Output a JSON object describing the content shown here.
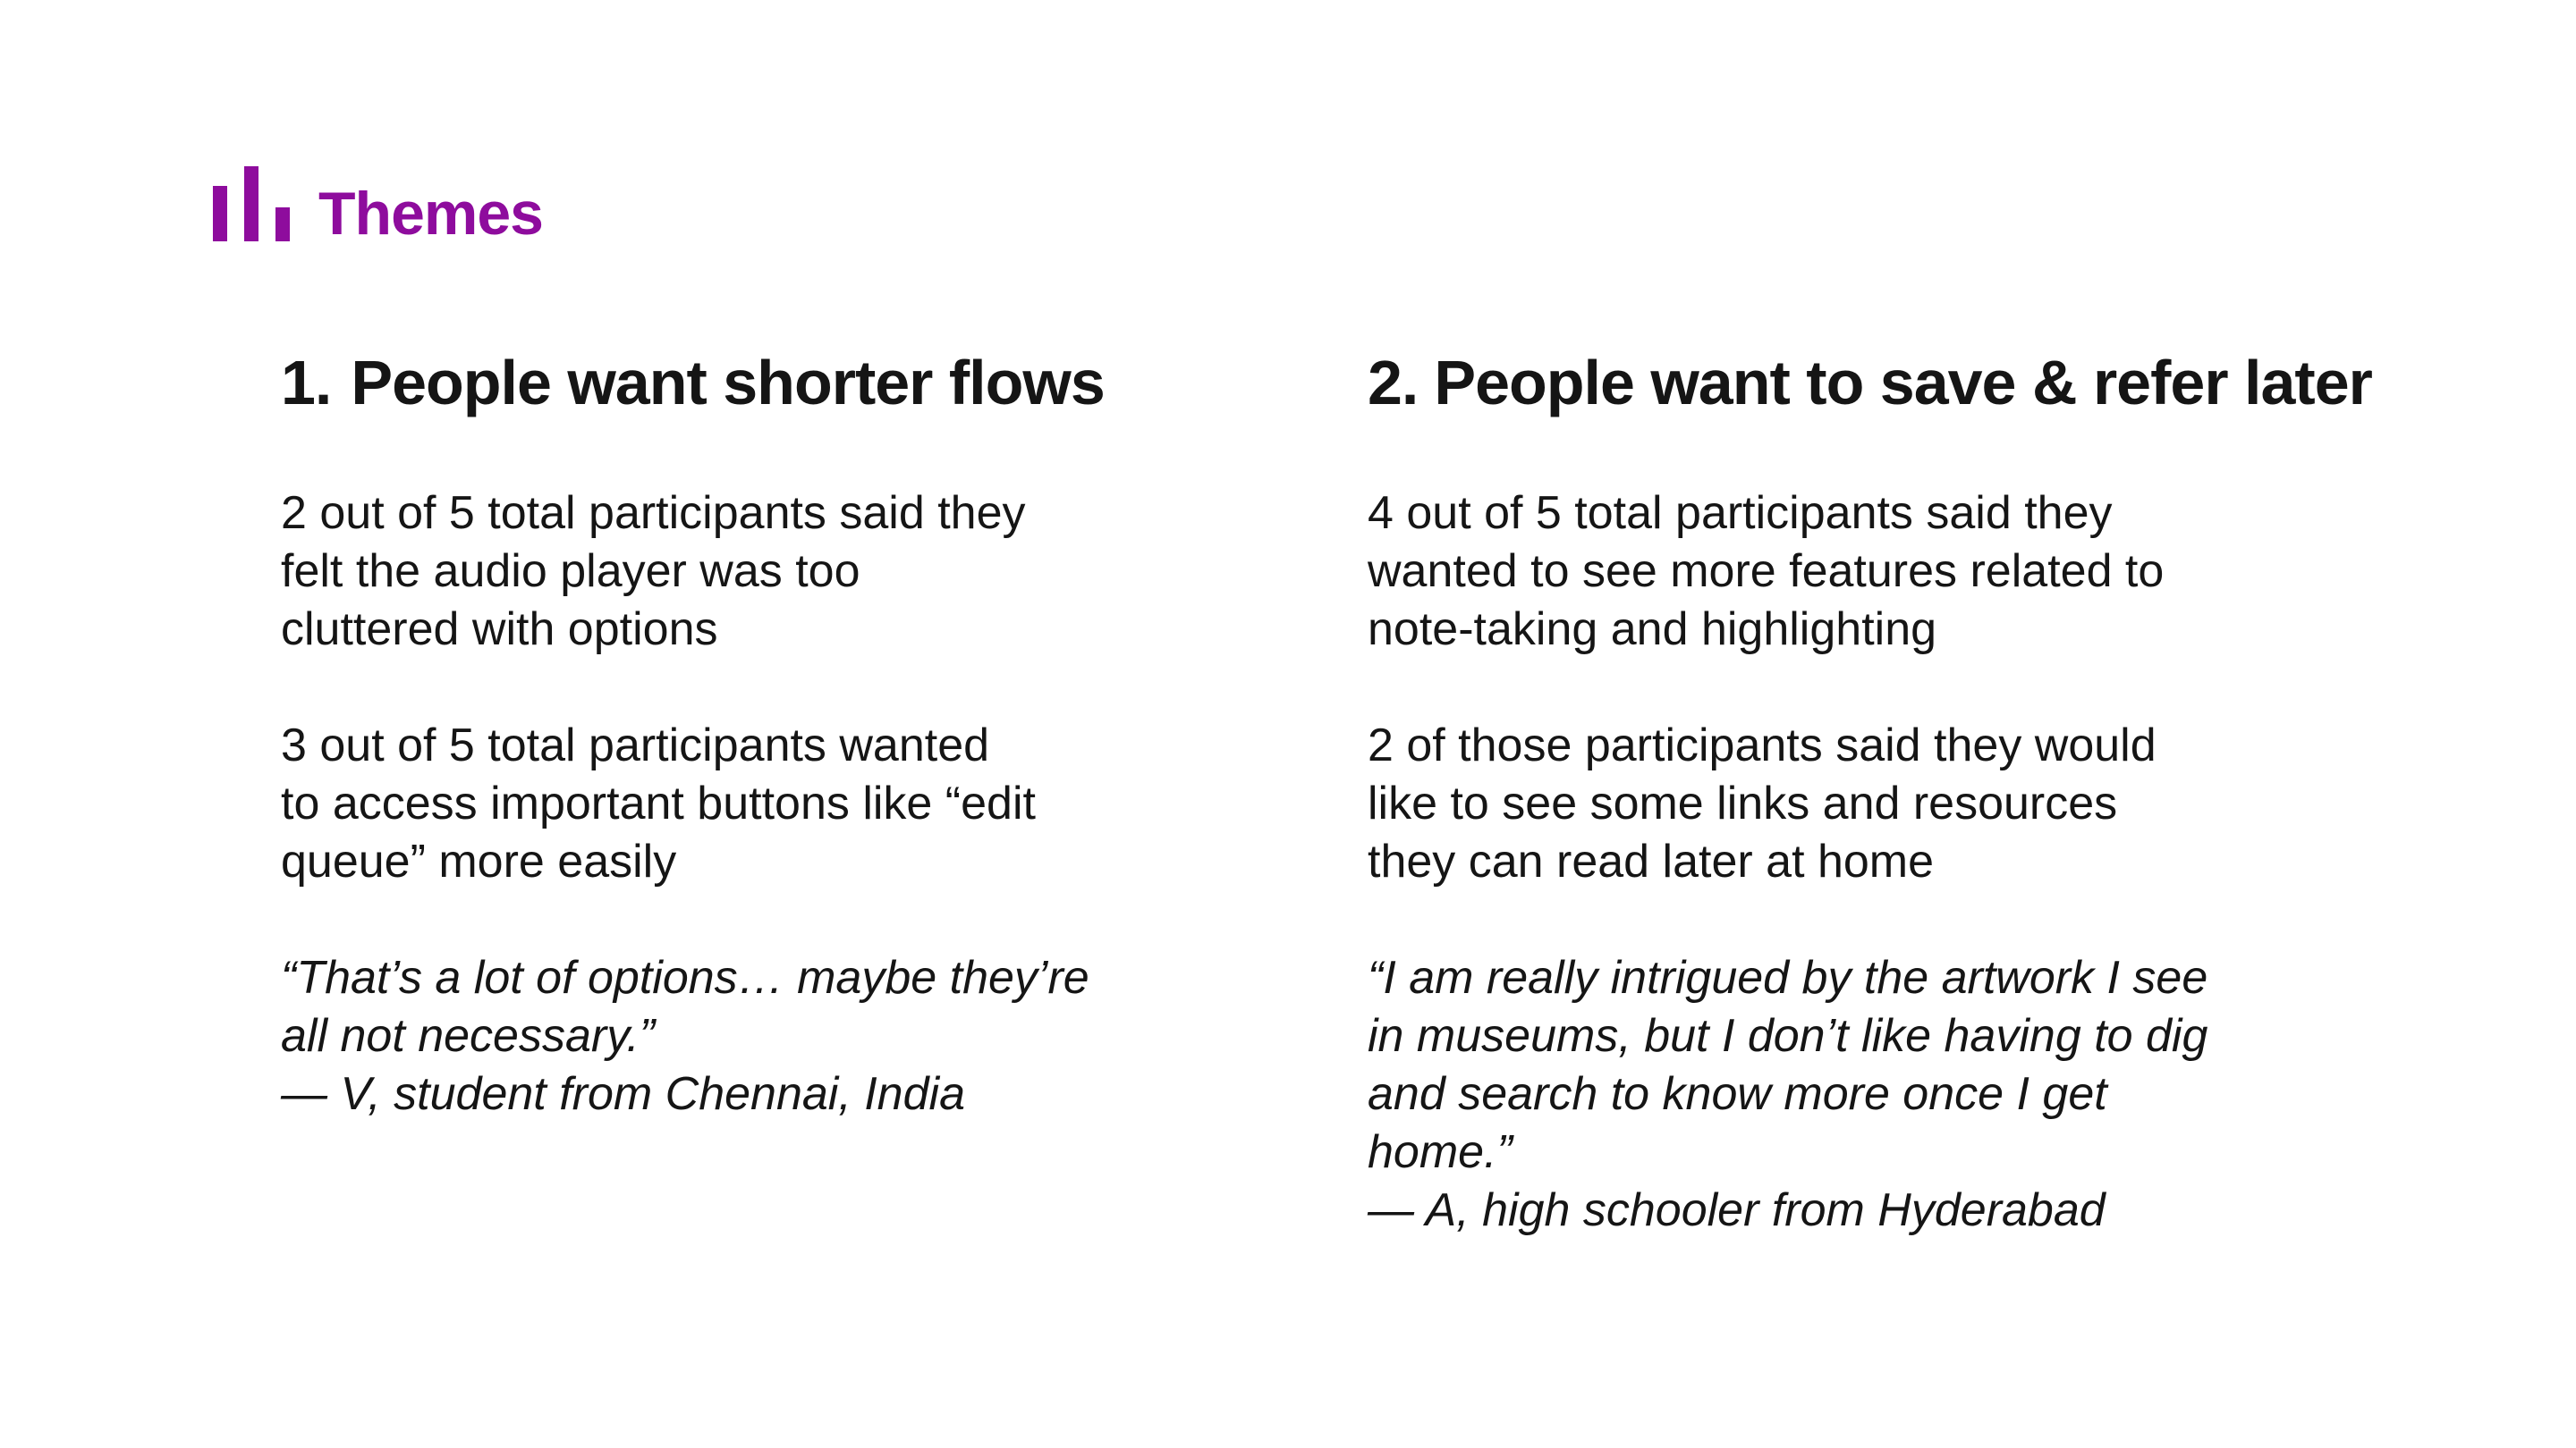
{
  "header": {
    "icon": "bar-chart-icon",
    "title": "Themes",
    "accent_color": "#8e0c9d"
  },
  "themes": [
    {
      "number": "1.",
      "heading": "People want shorter flows",
      "paragraphs": [
        "2 out of 5 total participants said they\nfelt the audio player was too\ncluttered with options",
        "3 out of 5 total participants wanted\nto access important buttons like “edit\nqueue” more easily"
      ],
      "quote": "“That’s a lot of options… maybe they’re\nall not necessary.”",
      "attribution": "— V, student from Chennai, India"
    },
    {
      "number": "2.",
      "heading": "People want to save & refer later",
      "paragraphs": [
        "4 out of 5 total participants said they\nwanted to see more features related to\nnote-taking and highlighting",
        "2 of those participants said they would\nlike to see some links and resources\nthey can read later at home"
      ],
      "quote": "“I am really intrigued by the artwork I see\nin museums, but I don’t like having to dig\nand search to know more once I get\nhome.”",
      "attribution": "— A, high schooler from Hyderabad"
    }
  ]
}
